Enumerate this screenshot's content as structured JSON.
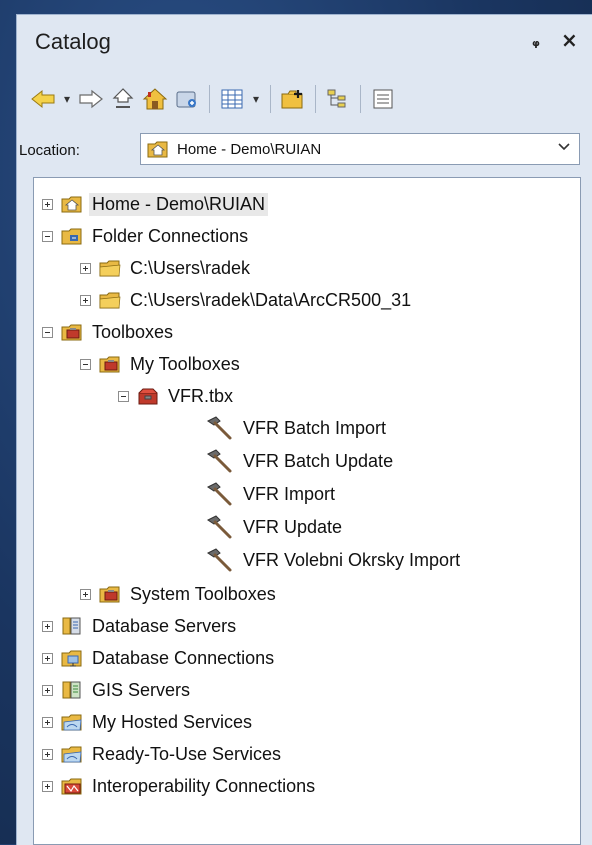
{
  "window": {
    "title": "Catalog",
    "pin_glyph": "q",
    "close_glyph": "×"
  },
  "toolbar": {
    "buttons": [
      "back-icon",
      "forward-icon",
      "up-level-icon",
      "home-icon",
      "connect-folder-icon",
      "view-options-icon",
      "add-toolbox-icon",
      "toggle-contents-icon",
      "details-icon"
    ]
  },
  "location": {
    "label": "Location:",
    "value": "Home - Demo\\RUIAN"
  },
  "tree": {
    "items": [
      {
        "label": "Home - Demo\\RUIAN"
      },
      {
        "label": "Folder Connections"
      },
      {
        "label": "C:\\Users\\radek"
      },
      {
        "label": "C:\\Users\\radek\\Data\\ArcCR500_31"
      },
      {
        "label": "Toolboxes"
      },
      {
        "label": "My Toolboxes"
      },
      {
        "label": "VFR.tbx"
      },
      {
        "label": "VFR Batch Import"
      },
      {
        "label": "VFR Batch Update"
      },
      {
        "label": "VFR Import"
      },
      {
        "label": "VFR Update"
      },
      {
        "label": "VFR Volebni Okrsky Import"
      },
      {
        "label": "System Toolboxes"
      },
      {
        "label": "Database Servers"
      },
      {
        "label": "Database Connections"
      },
      {
        "label": "GIS Servers"
      },
      {
        "label": "My Hosted Services"
      },
      {
        "label": "Ready-To-Use Services"
      },
      {
        "label": "Interoperability Connections"
      }
    ]
  },
  "colors": {
    "background": "#1c3a66",
    "panel": "#dfe7f2",
    "folder_yellow": "#e9b944",
    "toolbox_red": "#c0392b",
    "selection": "#e8e8e8"
  }
}
